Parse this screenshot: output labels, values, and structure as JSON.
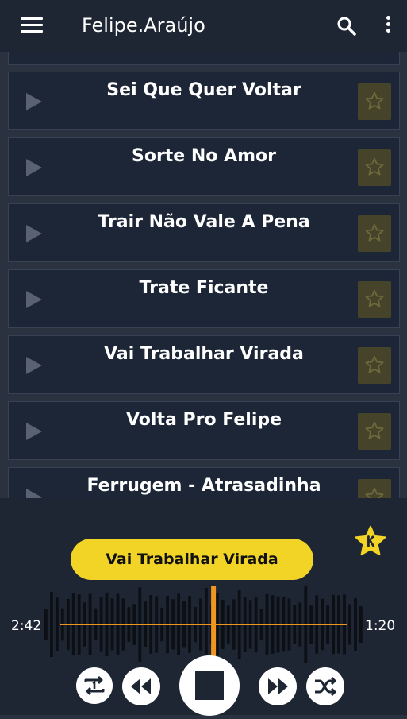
{
  "app_title": "Felipe.Araújo",
  "songs": [
    {
      "title": "Sei Que Quer Voltar"
    },
    {
      "title": "Sorte No Amor"
    },
    {
      "title": "Trair Não Vale A Pena"
    },
    {
      "title": "Trate Ficante"
    },
    {
      "title": "Vai Trabalhar Virada"
    },
    {
      "title": "Volta Pro Felipe"
    },
    {
      "title": "Ferrugem - Atrasadinha"
    }
  ],
  "player": {
    "now_playing": "Vai Trabalhar Virada",
    "elapsed": "2:42",
    "remaining": "1:20",
    "progress_fraction": 0.53
  },
  "colors": {
    "accent": "#f2d427",
    "progress": "#f0961e",
    "background": "#2a3240",
    "card": "#1d2637"
  },
  "icons": [
    "menu-icon",
    "search-icon",
    "more-vert-icon",
    "play-icon",
    "star-icon",
    "repeat-one-icon",
    "rewind-icon",
    "stop-icon",
    "fast-forward-icon",
    "shuffle-icon"
  ]
}
